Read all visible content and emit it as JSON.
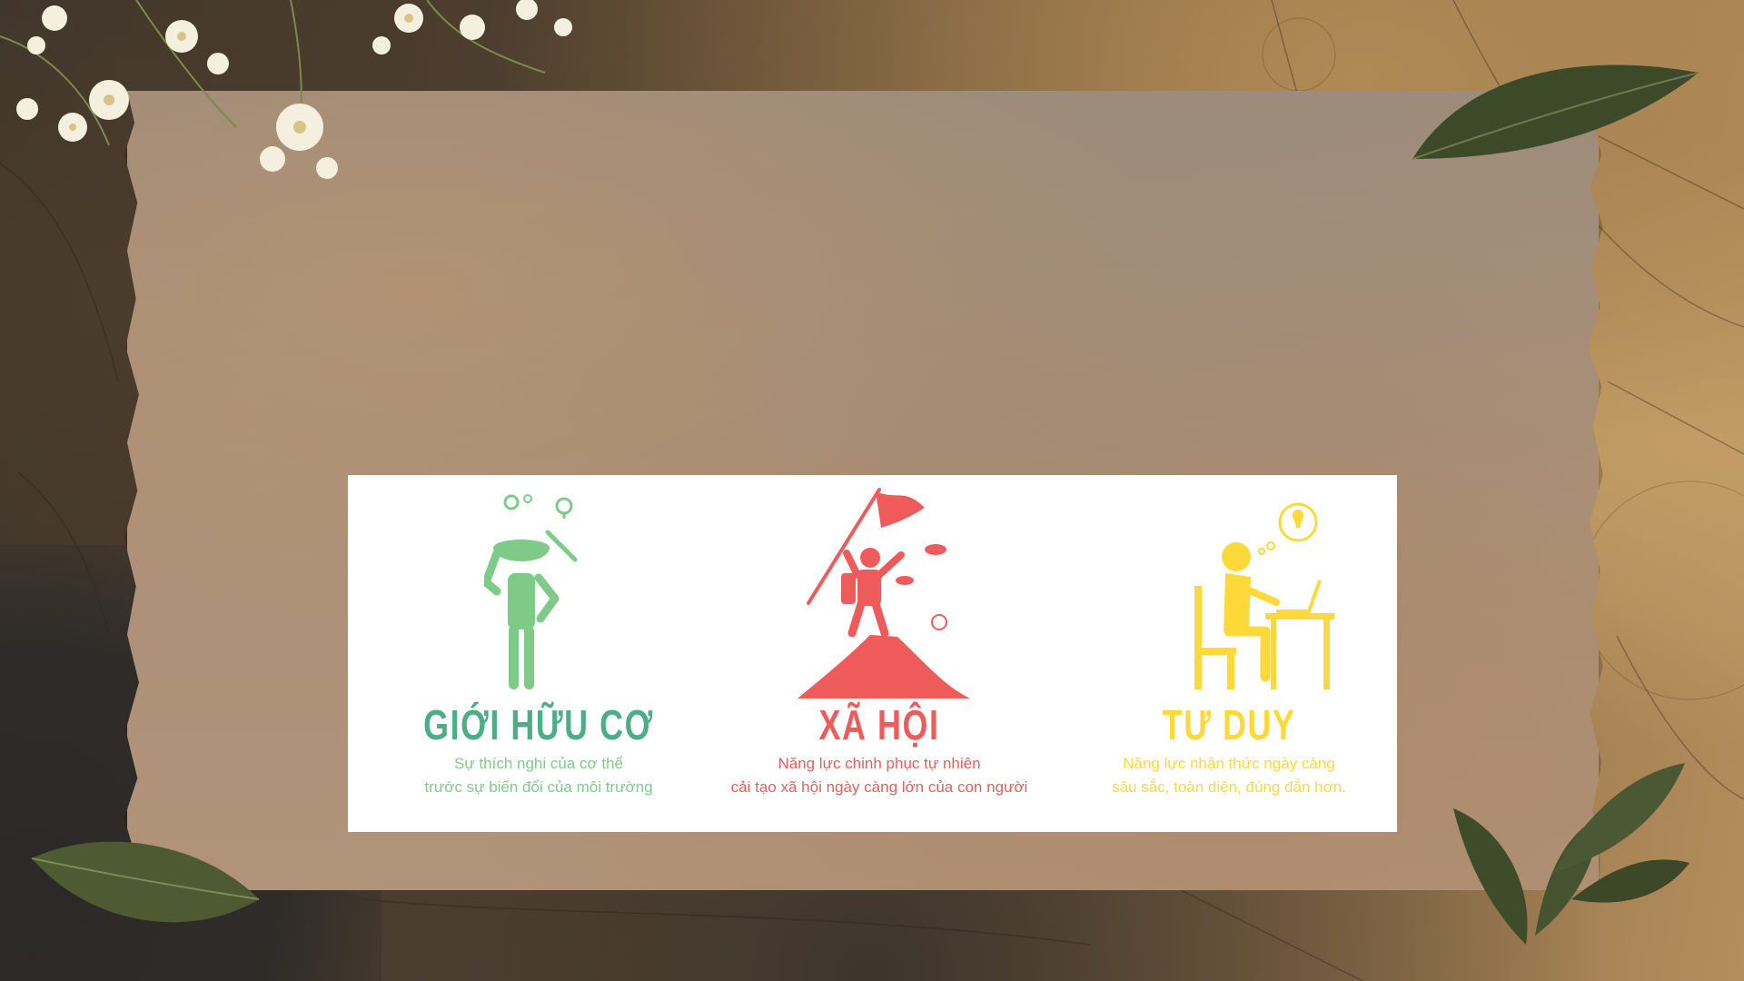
{
  "slide": {
    "colors": {
      "green": "#7ecb88",
      "green_title": "#4cae85",
      "red": "#ef5b5b",
      "yellow": "#ffd93a",
      "paper": "#ab9078",
      "card": "#ffffff"
    },
    "columns": [
      {
        "icon": "person-thinking-gears-icon",
        "title": "GIỚI HỮU CƠ",
        "desc_line1": "Sự thích nghi của cơ thể",
        "desc_line2": "trước sự biến đổi của môi trường"
      },
      {
        "icon": "mountain-flag-climber-icon",
        "title": "XÃ HỘI",
        "desc_line1": "Năng lực chinh phục tự nhiên",
        "desc_line2": "cải tạo xã hội ngày càng lớn của con người"
      },
      {
        "icon": "person-laptop-idea-icon",
        "title": "TƯ DUY",
        "desc_line1": "Năng lực nhận thức ngày càng",
        "desc_line2": "sâu sắc, toàn diện, đúng đắn hơn."
      }
    ]
  }
}
